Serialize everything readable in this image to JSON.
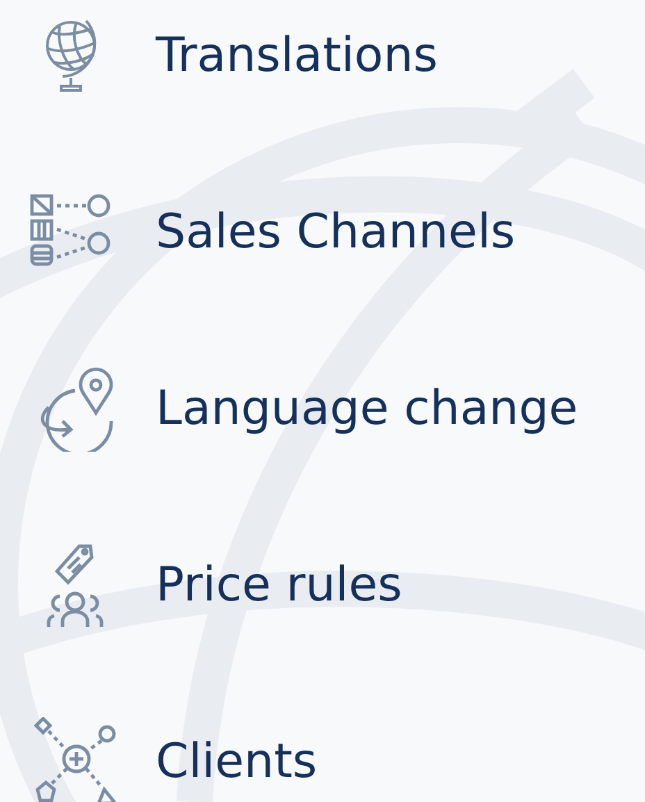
{
  "features": [
    {
      "kind": "globe",
      "label": "Translations"
    },
    {
      "kind": "channels",
      "label": "Sales Channels"
    },
    {
      "kind": "location",
      "label": "Language change"
    },
    {
      "kind": "price",
      "label": "Price rules"
    },
    {
      "kind": "clients",
      "label": "Clients"
    }
  ]
}
